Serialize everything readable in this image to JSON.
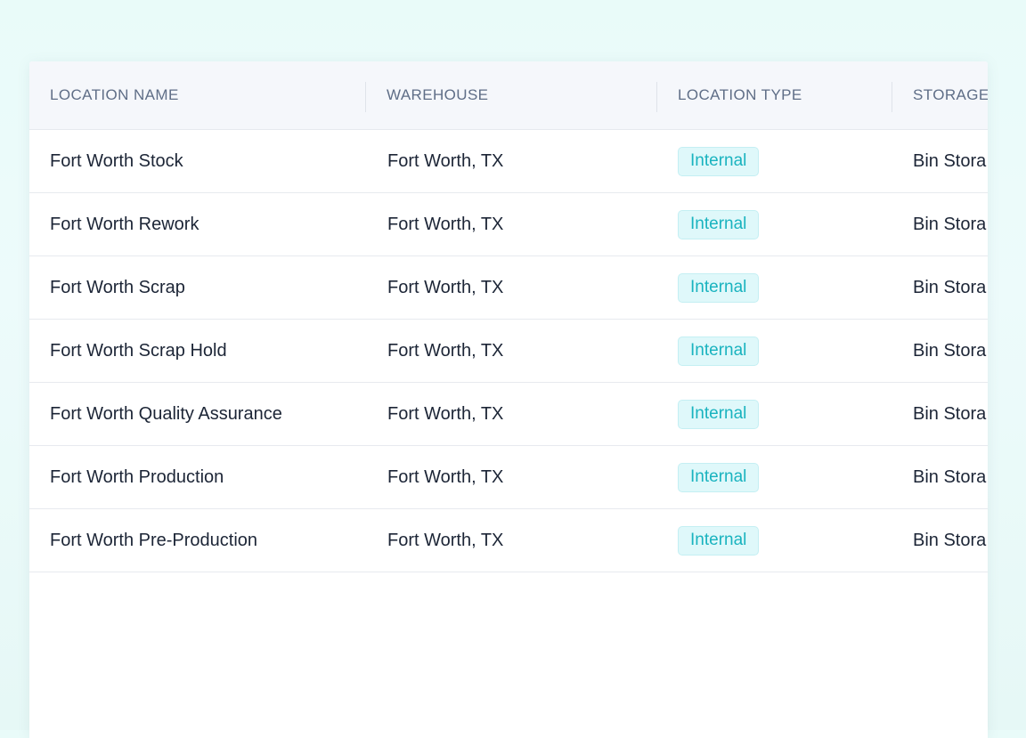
{
  "table": {
    "columns": [
      "LOCATION NAME",
      "WAREHOUSE",
      "LOCATION TYPE",
      "STORAGE"
    ],
    "rows": [
      {
        "location_name": "Fort Worth Stock",
        "warehouse": "Fort Worth, TX",
        "location_type": "Internal",
        "storage": "Bin Stora"
      },
      {
        "location_name": "Fort Worth Rework",
        "warehouse": "Fort Worth, TX",
        "location_type": "Internal",
        "storage": "Bin Stora"
      },
      {
        "location_name": "Fort Worth Scrap",
        "warehouse": "Fort Worth, TX",
        "location_type": "Internal",
        "storage": "Bin Stora"
      },
      {
        "location_name": "Fort Worth Scrap Hold",
        "warehouse": "Fort Worth, TX",
        "location_type": "Internal",
        "storage": "Bin Stora"
      },
      {
        "location_name": "Fort Worth Quality Assurance",
        "warehouse": "Fort Worth, TX",
        "location_type": "Internal",
        "storage": "Bin Stora"
      },
      {
        "location_name": "Fort Worth Production",
        "warehouse": "Fort Worth, TX",
        "location_type": "Internal",
        "storage": "Bin Stora"
      },
      {
        "location_name": "Fort Worth Pre-Production",
        "warehouse": "Fort Worth, TX",
        "location_type": "Internal",
        "storage": "Bin Stora"
      }
    ]
  },
  "colors": {
    "page_background": "#e9fbf9",
    "header_background": "#f5f7fb",
    "header_text": "#5f6e87",
    "cell_text": "#1c2536",
    "badge_background": "#dff8fa",
    "badge_text": "#19b3bf"
  }
}
